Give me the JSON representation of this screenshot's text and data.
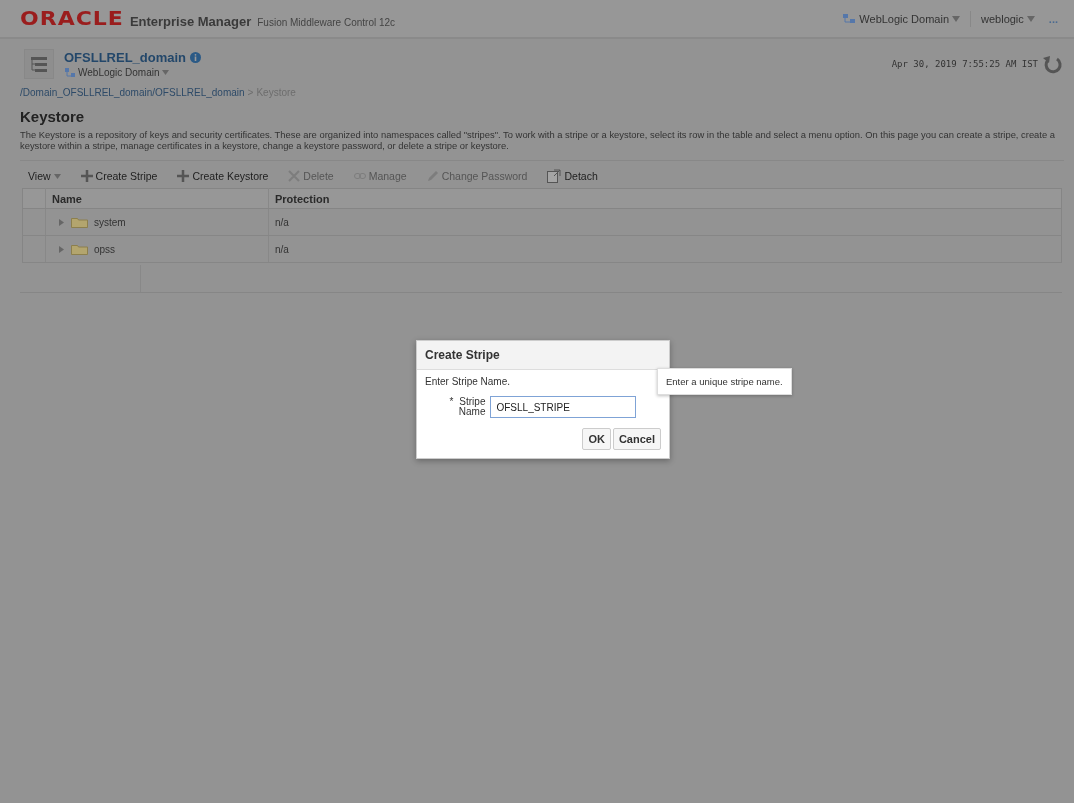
{
  "header": {
    "logo": "ORACLE",
    "product": "Enterprise Manager",
    "subtitle": "Fusion Middleware Control 12c",
    "target_menu": "WebLogic Domain",
    "user_menu": "weblogic",
    "more": "..."
  },
  "target": {
    "name": "OFSLLREL_domain",
    "type": "WebLogic Domain",
    "timestamp": "Apr 30, 2019 7:55:25 AM IST"
  },
  "breadcrumb": {
    "path": "/Domain_OFSLLREL_domain/OFSLLREL_domain",
    "separator": ">",
    "current": "Keystore"
  },
  "page": {
    "title": "Keystore",
    "description": "The Keystore is a repository of keys and security certificates. These are organized into namespaces called \"stripes\". To work with a stripe or a keystore, select its row in the table and select a menu option. On this page you can create a stripe, create a keystore within a stripe, manage certificates in a keystore, change a keystore password, or delete a stripe or keystore."
  },
  "toolbar": [
    {
      "kind": "menu",
      "label": "View",
      "disabled": false
    },
    {
      "kind": "plus",
      "label": "Create Stripe",
      "disabled": false
    },
    {
      "kind": "plus",
      "label": "Create Keystore",
      "disabled": false
    },
    {
      "kind": "delete",
      "label": "Delete",
      "disabled": true
    },
    {
      "kind": "manage",
      "label": "Manage",
      "disabled": true
    },
    {
      "kind": "pencil",
      "label": "Change Password",
      "disabled": true
    },
    {
      "kind": "detach",
      "label": "Detach",
      "disabled": false
    }
  ],
  "table": {
    "columns": [
      "Name",
      "Protection"
    ],
    "rows": [
      {
        "name": "system",
        "protection": "n/a",
        "expanded": false
      },
      {
        "name": "opss",
        "protection": "n/a",
        "expanded": false
      }
    ]
  },
  "dialog": {
    "title": "Create Stripe",
    "prompt": "Enter Stripe Name.",
    "field_label": "Stripe Name",
    "required_mark": "*",
    "value": "OFSLL_STRIPE",
    "tooltip": "Enter a unique stripe name.",
    "buttons": [
      "OK",
      "Cancel"
    ]
  }
}
